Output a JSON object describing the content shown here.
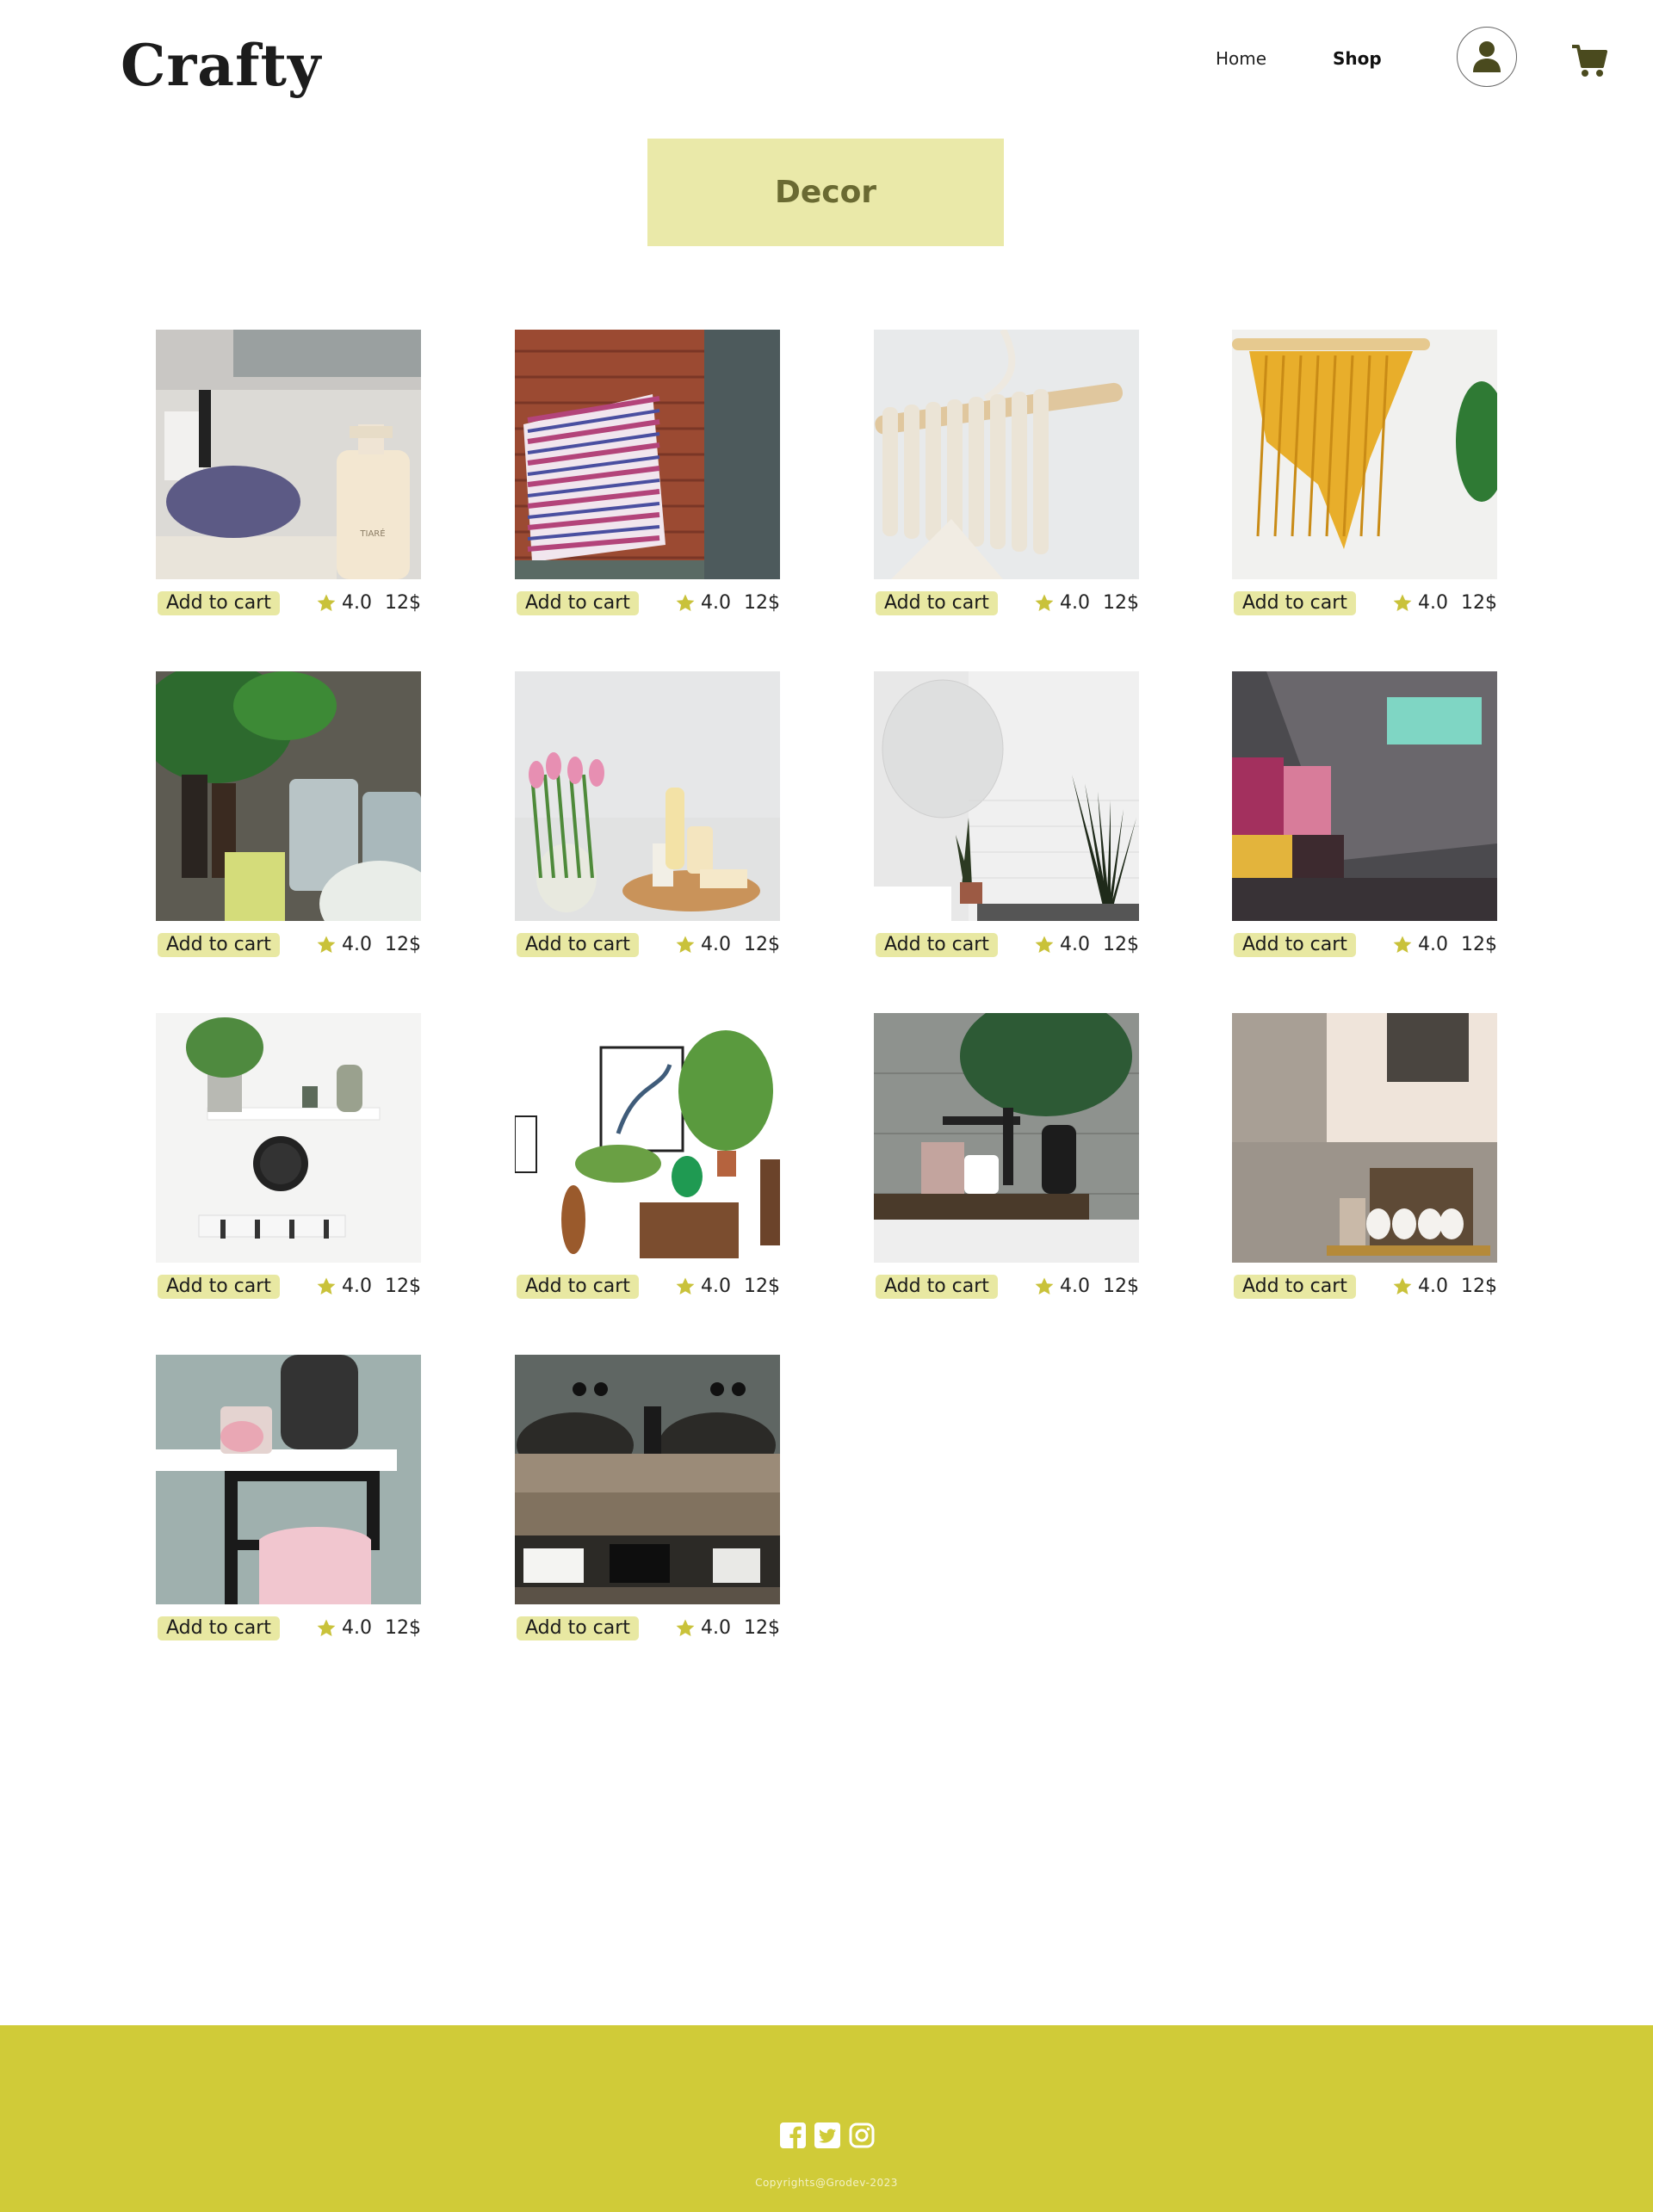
{
  "header": {
    "logo": "Crafty",
    "nav": [
      {
        "label": "Home"
      },
      {
        "label": "Shop"
      }
    ]
  },
  "category": {
    "title": "Decor"
  },
  "products": [
    {
      "cta": "Add to cart",
      "rating": "4.0",
      "price": "12$",
      "image": "towel-and-soap-dispenser"
    },
    {
      "cta": "Add to cart",
      "rating": "4.0",
      "price": "12$",
      "image": "striped-pillow"
    },
    {
      "cta": "Add to cart",
      "rating": "4.0",
      "price": "12$",
      "image": "white-macrame-wall-hanging"
    },
    {
      "cta": "Add to cart",
      "rating": "4.0",
      "price": "12$",
      "image": "yellow-macrame-wall-hanging"
    },
    {
      "cta": "Add to cart",
      "rating": "4.0",
      "price": "12$",
      "image": "candles-and-plants"
    },
    {
      "cta": "Add to cart",
      "rating": "4.0",
      "price": "12$",
      "image": "tulips-and-bath-tray"
    },
    {
      "cta": "Add to cart",
      "rating": "4.0",
      "price": "12$",
      "image": "bathroom-plants"
    },
    {
      "cta": "Add to cart",
      "rating": "4.0",
      "price": "12$",
      "image": "patchwork-quilt"
    },
    {
      "cta": "Add to cart",
      "rating": "4.0",
      "price": "12$",
      "image": "wall-shelf-with-clock"
    },
    {
      "cta": "Add to cart",
      "rating": "4.0",
      "price": "12$",
      "image": "wall-decor-shelf"
    },
    {
      "cta": "Add to cart",
      "rating": "4.0",
      "price": "12$",
      "image": "bathtub-faucet"
    },
    {
      "cta": "Add to cart",
      "rating": "4.0",
      "price": "12$",
      "image": "bathroom-cabinet"
    },
    {
      "cta": "Add to cart",
      "rating": "4.0",
      "price": "12$",
      "image": "towel-rack-shelf"
    },
    {
      "cta": "Add to cart",
      "rating": "4.0",
      "price": "12$",
      "image": "double-vessel-sinks"
    }
  ],
  "footer": {
    "social_icons": [
      "facebook-icon",
      "twitter-icon",
      "instagram-icon"
    ],
    "copyright": "Copyrights@Grodev-2023"
  },
  "colors": {
    "banner": "#eae9a9",
    "button": "#e8e8a2",
    "star": "#c9c23a",
    "footer": "#d0cb38",
    "icon": "#4a4a1e"
  }
}
